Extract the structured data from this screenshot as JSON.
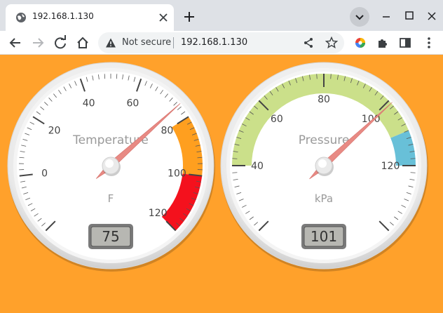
{
  "browser": {
    "tab": {
      "title": "192.168.1.130"
    },
    "address_bar": {
      "security_label": "Not secure",
      "url": "192.168.1.130"
    }
  },
  "gauges": [
    {
      "title": "Temperature",
      "units": "F",
      "value": 75,
      "value_display": "75",
      "min": -20,
      "max": 120,
      "major_ticks": [
        "0",
        "20",
        "40",
        "60",
        "80",
        "100",
        "120"
      ],
      "minor_ticks_per_major": 10,
      "highlights": [
        {
          "from": 80,
          "to": 100,
          "color": "#ff9f1f"
        },
        {
          "from": 100,
          "to": 120,
          "color": "#f4111d"
        }
      ],
      "needle_color": "#e88a84"
    },
    {
      "title": "Pressure",
      "units": "kPa",
      "value": 101,
      "value_display": "101",
      "min": 20,
      "max": 140,
      "major_ticks": [
        "40",
        "60",
        "80",
        "100",
        "120"
      ],
      "minor_ticks_per_major": 10,
      "highlights": [
        {
          "from": 40,
          "to": 110,
          "color": "#cbe08a"
        },
        {
          "from": 110,
          "to": 120,
          "color": "#68c0d8"
        }
      ],
      "needle_color": "#e88a84"
    }
  ]
}
